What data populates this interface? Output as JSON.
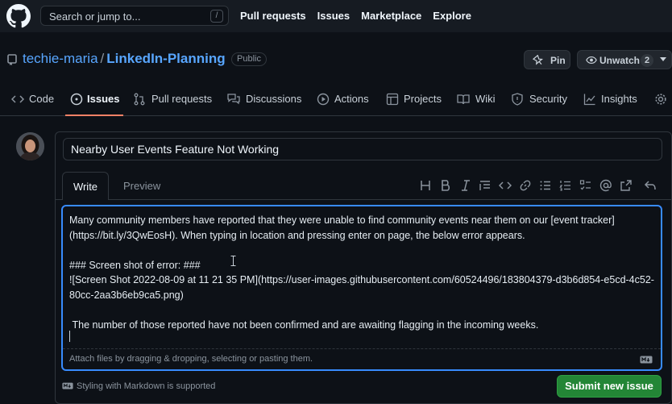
{
  "header": {
    "search_placeholder": "Search or jump to...",
    "search_shortcut": "/",
    "nav": [
      "Pull requests",
      "Issues",
      "Marketplace",
      "Explore"
    ]
  },
  "repo": {
    "owner": "techie-maria",
    "separator": "/",
    "name": "LinkedIn-Planning",
    "visibility": "Public",
    "pin_label": "Pin",
    "watch_label": "Unwatch",
    "watch_count": "2"
  },
  "tabs": [
    "Code",
    "Issues",
    "Pull requests",
    "Discussions",
    "Actions",
    "Projects",
    "Wiki",
    "Security",
    "Insights"
  ],
  "issue_form": {
    "title_value": "Nearby User Events Feature Not Working",
    "write_tab": "Write",
    "preview_tab": "Preview",
    "body": "Many community members have reported that they were unable to find community events near them on our [event tracker] (https://bit.ly/3QwEosH). When typing in location and pressing enter on page, the below error appears.\n\n### Screen shot of error: ###\n![Screen Shot 2022-08-09 at 11 21 35 PM](https://user-images.githubusercontent.com/60524496/183804379-d3b6d854-e5cd-4c52-80cc-2aa3b6eb9ca5.png)\n\n The number of those reported have not been confirmed and are awaiting flagging in the incoming weeks.",
    "attach_hint": "Attach files by dragging & dropping, selecting or pasting them.",
    "markdown_note": "Styling with Markdown is supported",
    "submit_label": "Submit new issue"
  },
  "colors": {
    "accent": "#58a6ff",
    "active_tab": "#f78166",
    "submit": "#238636",
    "focus": "#388bfd"
  }
}
